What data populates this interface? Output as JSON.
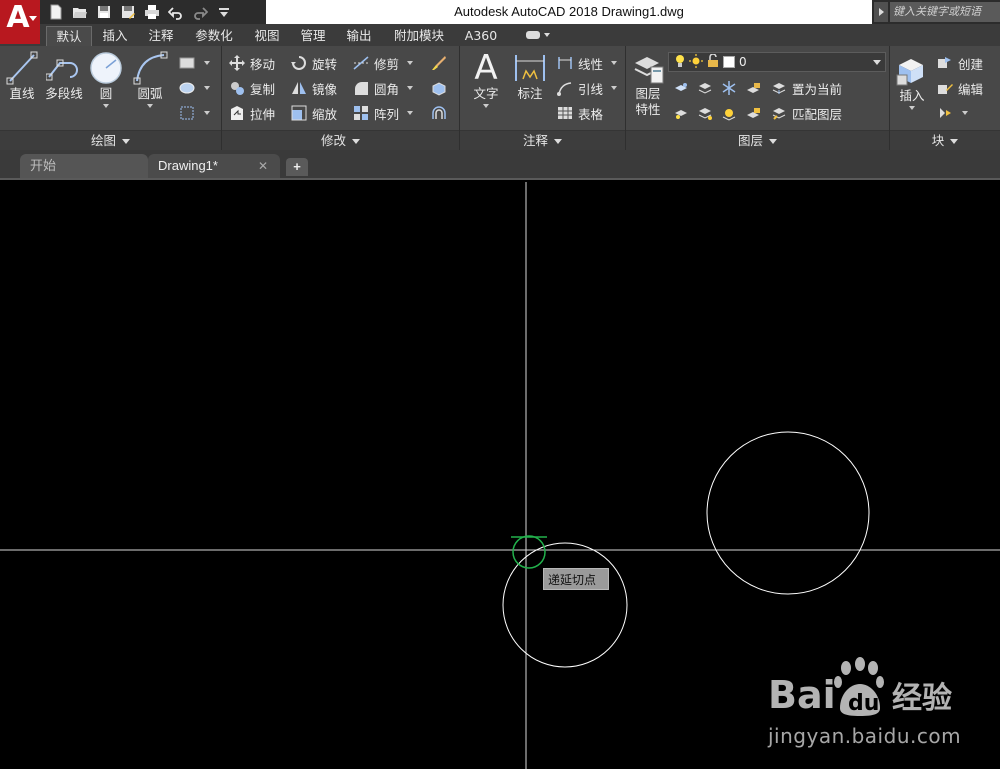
{
  "window": {
    "title": "Autodesk AutoCAD 2018    Drawing1.dwg"
  },
  "app_logo": {
    "letter": "A"
  },
  "search": {
    "placeholder": "键入关键字或短语"
  },
  "quick_access": [
    "new-icon",
    "open-icon",
    "save-icon",
    "save-as-icon",
    "plot-icon",
    "undo-icon",
    "redo-icon",
    "customize-icon"
  ],
  "ribbon_tabs": [
    "默认",
    "插入",
    "注释",
    "参数化",
    "视图",
    "管理",
    "输出",
    "附加模块",
    "A360"
  ],
  "active_tab": "默认",
  "panels": {
    "draw": {
      "title": "绘图",
      "line": "直线",
      "polyline": "多段线",
      "circle": "圆",
      "arc": "圆弧"
    },
    "modify": {
      "title": "修改",
      "move": "移动",
      "rotate": "旋转",
      "trim": "修剪",
      "copy": "复制",
      "mirror": "镜像",
      "fillet": "圆角",
      "stretch": "拉伸",
      "scale": "缩放",
      "array": "阵列"
    },
    "annotation": {
      "title": "注释",
      "text": "文字",
      "dimension": "标注",
      "linear": "线性",
      "leader": "引线",
      "table": "表格"
    },
    "layers": {
      "title": "图层",
      "properties_line1": "图层",
      "properties_line2": "特性",
      "current_layer": "0",
      "make_current": "置为当前",
      "match_layer": "匹配图层"
    },
    "block": {
      "title": "块",
      "insert": "插入",
      "create": "创建",
      "edit": "编辑"
    }
  },
  "file_tabs": {
    "start": "开始",
    "drawing": "Drawing1*",
    "close": "✕",
    "add": "+"
  },
  "canvas": {
    "osnap_tooltip": "递延切点",
    "colors": {
      "background": "#000000",
      "entity": "#ffffff",
      "snap_marker": "#22b14c"
    }
  },
  "watermark": {
    "brand": "Bai du 经验",
    "url": "jingyan.baidu.com"
  }
}
